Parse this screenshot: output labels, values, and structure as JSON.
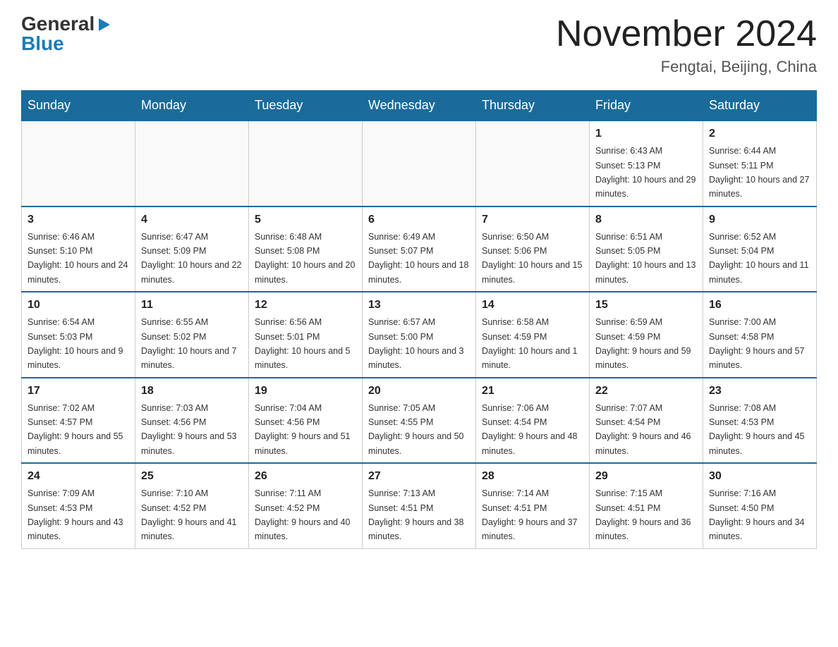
{
  "header": {
    "logo_general": "General",
    "logo_blue": "Blue",
    "month_title": "November 2024",
    "location": "Fengtai, Beijing, China"
  },
  "weekdays": [
    "Sunday",
    "Monday",
    "Tuesday",
    "Wednesday",
    "Thursday",
    "Friday",
    "Saturday"
  ],
  "weeks": [
    [
      {
        "day": "",
        "info": ""
      },
      {
        "day": "",
        "info": ""
      },
      {
        "day": "",
        "info": ""
      },
      {
        "day": "",
        "info": ""
      },
      {
        "day": "",
        "info": ""
      },
      {
        "day": "1",
        "info": "Sunrise: 6:43 AM\nSunset: 5:13 PM\nDaylight: 10 hours and 29 minutes."
      },
      {
        "day": "2",
        "info": "Sunrise: 6:44 AM\nSunset: 5:11 PM\nDaylight: 10 hours and 27 minutes."
      }
    ],
    [
      {
        "day": "3",
        "info": "Sunrise: 6:46 AM\nSunset: 5:10 PM\nDaylight: 10 hours and 24 minutes."
      },
      {
        "day": "4",
        "info": "Sunrise: 6:47 AM\nSunset: 5:09 PM\nDaylight: 10 hours and 22 minutes."
      },
      {
        "day": "5",
        "info": "Sunrise: 6:48 AM\nSunset: 5:08 PM\nDaylight: 10 hours and 20 minutes."
      },
      {
        "day": "6",
        "info": "Sunrise: 6:49 AM\nSunset: 5:07 PM\nDaylight: 10 hours and 18 minutes."
      },
      {
        "day": "7",
        "info": "Sunrise: 6:50 AM\nSunset: 5:06 PM\nDaylight: 10 hours and 15 minutes."
      },
      {
        "day": "8",
        "info": "Sunrise: 6:51 AM\nSunset: 5:05 PM\nDaylight: 10 hours and 13 minutes."
      },
      {
        "day": "9",
        "info": "Sunrise: 6:52 AM\nSunset: 5:04 PM\nDaylight: 10 hours and 11 minutes."
      }
    ],
    [
      {
        "day": "10",
        "info": "Sunrise: 6:54 AM\nSunset: 5:03 PM\nDaylight: 10 hours and 9 minutes."
      },
      {
        "day": "11",
        "info": "Sunrise: 6:55 AM\nSunset: 5:02 PM\nDaylight: 10 hours and 7 minutes."
      },
      {
        "day": "12",
        "info": "Sunrise: 6:56 AM\nSunset: 5:01 PM\nDaylight: 10 hours and 5 minutes."
      },
      {
        "day": "13",
        "info": "Sunrise: 6:57 AM\nSunset: 5:00 PM\nDaylight: 10 hours and 3 minutes."
      },
      {
        "day": "14",
        "info": "Sunrise: 6:58 AM\nSunset: 4:59 PM\nDaylight: 10 hours and 1 minute."
      },
      {
        "day": "15",
        "info": "Sunrise: 6:59 AM\nSunset: 4:59 PM\nDaylight: 9 hours and 59 minutes."
      },
      {
        "day": "16",
        "info": "Sunrise: 7:00 AM\nSunset: 4:58 PM\nDaylight: 9 hours and 57 minutes."
      }
    ],
    [
      {
        "day": "17",
        "info": "Sunrise: 7:02 AM\nSunset: 4:57 PM\nDaylight: 9 hours and 55 minutes."
      },
      {
        "day": "18",
        "info": "Sunrise: 7:03 AM\nSunset: 4:56 PM\nDaylight: 9 hours and 53 minutes."
      },
      {
        "day": "19",
        "info": "Sunrise: 7:04 AM\nSunset: 4:56 PM\nDaylight: 9 hours and 51 minutes."
      },
      {
        "day": "20",
        "info": "Sunrise: 7:05 AM\nSunset: 4:55 PM\nDaylight: 9 hours and 50 minutes."
      },
      {
        "day": "21",
        "info": "Sunrise: 7:06 AM\nSunset: 4:54 PM\nDaylight: 9 hours and 48 minutes."
      },
      {
        "day": "22",
        "info": "Sunrise: 7:07 AM\nSunset: 4:54 PM\nDaylight: 9 hours and 46 minutes."
      },
      {
        "day": "23",
        "info": "Sunrise: 7:08 AM\nSunset: 4:53 PM\nDaylight: 9 hours and 45 minutes."
      }
    ],
    [
      {
        "day": "24",
        "info": "Sunrise: 7:09 AM\nSunset: 4:53 PM\nDaylight: 9 hours and 43 minutes."
      },
      {
        "day": "25",
        "info": "Sunrise: 7:10 AM\nSunset: 4:52 PM\nDaylight: 9 hours and 41 minutes."
      },
      {
        "day": "26",
        "info": "Sunrise: 7:11 AM\nSunset: 4:52 PM\nDaylight: 9 hours and 40 minutes."
      },
      {
        "day": "27",
        "info": "Sunrise: 7:13 AM\nSunset: 4:51 PM\nDaylight: 9 hours and 38 minutes."
      },
      {
        "day": "28",
        "info": "Sunrise: 7:14 AM\nSunset: 4:51 PM\nDaylight: 9 hours and 37 minutes."
      },
      {
        "day": "29",
        "info": "Sunrise: 7:15 AM\nSunset: 4:51 PM\nDaylight: 9 hours and 36 minutes."
      },
      {
        "day": "30",
        "info": "Sunrise: 7:16 AM\nSunset: 4:50 PM\nDaylight: 9 hours and 34 minutes."
      }
    ]
  ]
}
